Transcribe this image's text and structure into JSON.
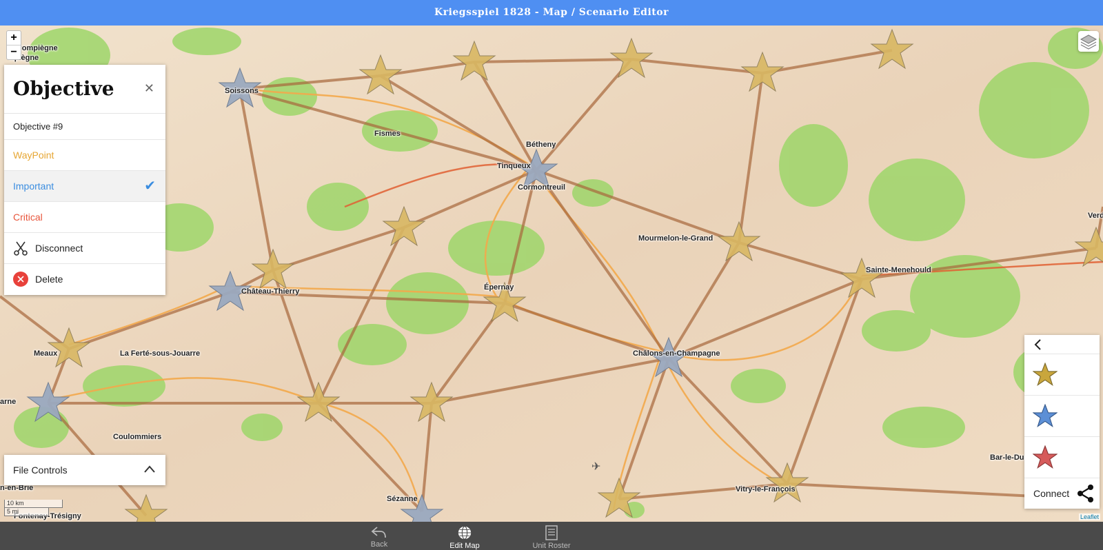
{
  "app": {
    "title": "Kriegsspiel 1828 - Map / Scenario Editor"
  },
  "map": {
    "zoom_in_label": "+",
    "zoom_out_label": "−",
    "places": [
      "Soissons",
      "Fismes",
      "Bétheny",
      "Tinqueux",
      "Cormontreuil",
      "Mourmelon-le-Grand",
      "Sainte-Menehould",
      "Château-Thierry",
      "Épernay",
      "Châlons-en-Champagne",
      "Meaux",
      "La Ferté-sous-Jouarre",
      "Coulommiers",
      "Sézanne",
      "Vitry-le-François",
      "Bar-le-Duc",
      "n-en-Brie",
      "arne",
      "Fontenay-Trésigny",
      "s-Compiègne",
      "npiègne",
      "Verd"
    ],
    "scale": {
      "km": "10 km",
      "mi": "5 mi"
    },
    "attribution": "Leaflet"
  },
  "objective_panel": {
    "title": "Objective",
    "name": "Objective #9",
    "types": [
      {
        "label": "WayPoint",
        "color": "#e6a633"
      },
      {
        "label": "Important",
        "color": "#3b8de0",
        "selected": true
      },
      {
        "label": "Critical",
        "color": "#e8553b"
      }
    ],
    "disconnect_label": "Disconnect",
    "delete_label": "Delete"
  },
  "file_controls": {
    "label": "File Controls"
  },
  "tool_panel": {
    "stars": [
      "gold-star-icon",
      "blue-star-icon",
      "red-star-icon"
    ],
    "connect_label": "Connect"
  },
  "bottom_nav": {
    "items": [
      {
        "label": "Back"
      },
      {
        "label": "Edit Map",
        "active": true
      },
      {
        "label": "Unit Roster"
      }
    ]
  }
}
